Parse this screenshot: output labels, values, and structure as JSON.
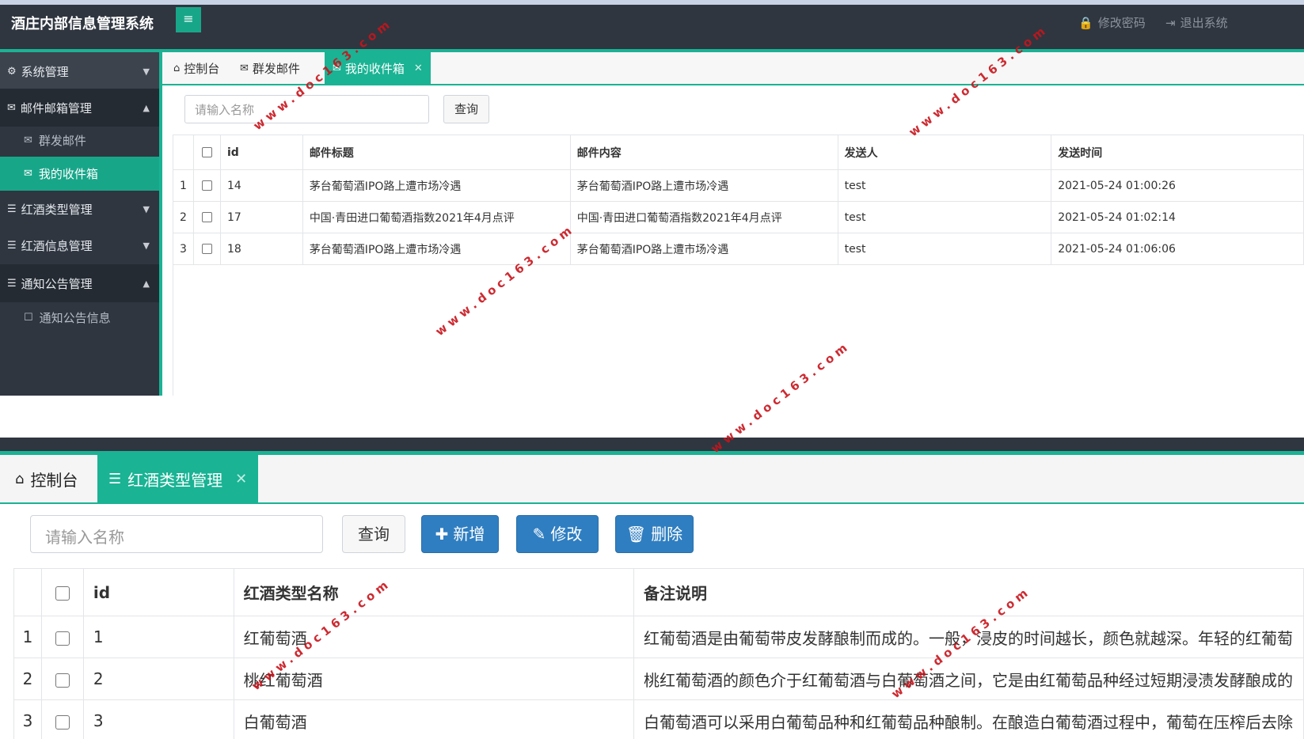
{
  "top": {
    "app_title": "酒庄内部信息管理系统",
    "menu_toggle_icon": "≡",
    "header_links": [
      {
        "icon": "lock-icon",
        "label": "修改密码"
      },
      {
        "icon": "sign-out-icon",
        "label": "退出系统"
      }
    ],
    "sidebar": {
      "items": [
        {
          "label": "系统管理",
          "icon": "gear-icon",
          "expanded": false
        },
        {
          "label": "邮件邮箱管理",
          "icon": "envelope-icon",
          "expanded": true
        },
        {
          "label": "群发邮件",
          "icon": "envelope-icon",
          "sub": true
        },
        {
          "label": "我的收件箱",
          "icon": "envelope-icon",
          "sub": true,
          "active": true
        },
        {
          "label": "红酒类型管理",
          "icon": "list-icon",
          "expanded": false
        },
        {
          "label": "红酒信息管理",
          "icon": "list-icon",
          "expanded": false
        },
        {
          "label": "通知公告管理",
          "icon": "list-icon",
          "expanded": true
        },
        {
          "label": "通知公告信息",
          "icon": "square-icon",
          "sub": true
        }
      ]
    },
    "tabs": [
      {
        "label": "控制台",
        "icon": "home-icon"
      },
      {
        "label": "群发邮件",
        "icon": "envelope-icon"
      },
      {
        "label": "我的收件箱",
        "icon": "envelope-icon",
        "active": true
      }
    ],
    "search": {
      "placeholder": "请输入名称",
      "button": "查询"
    },
    "table": {
      "headers": [
        "id",
        "邮件标题",
        "邮件内容",
        "发送人",
        "发送时间"
      ],
      "rows": [
        {
          "n": "1",
          "id": "14",
          "title": "茅台葡萄酒IPO路上遭市场冷遇",
          "content": "茅台葡萄酒IPO路上遭市场冷遇",
          "sender": "test",
          "time": "2021-05-24 01:00:26"
        },
        {
          "n": "2",
          "id": "17",
          "title": "中国·青田进口葡萄酒指数2021年4月点评",
          "content": "中国·青田进口葡萄酒指数2021年4月点评",
          "sender": "test",
          "time": "2021-05-24 01:02:14"
        },
        {
          "n": "3",
          "id": "18",
          "title": "茅台葡萄酒IPO路上遭市场冷遇",
          "content": "茅台葡萄酒IPO路上遭市场冷遇",
          "sender": "test",
          "time": "2021-05-24 01:06:06"
        }
      ]
    }
  },
  "bottom": {
    "tabs": [
      {
        "label": "控制台",
        "icon": "home-icon"
      },
      {
        "label": "红酒类型管理",
        "icon": "list-icon",
        "active": true
      }
    ],
    "search": {
      "placeholder": "请输入名称",
      "button": "查询"
    },
    "buttons": {
      "add": "新增",
      "edit": "修改",
      "delete": "删除"
    },
    "table": {
      "headers": [
        "id",
        "红酒类型名称",
        "备注说明"
      ],
      "rows": [
        {
          "n": "1",
          "id": "1",
          "name": "红葡萄酒",
          "note": "红葡萄酒是由葡萄带皮发酵酿制而成的。一般，浸皮的时间越长，颜色就越深。年轻的红葡萄"
        },
        {
          "n": "2",
          "id": "2",
          "name": "桃红葡萄酒",
          "note": "桃红葡萄酒的颜色介于红葡萄酒与白葡萄酒之间，它是由红葡萄品种经过短期浸渍发酵酿成的"
        },
        {
          "n": "3",
          "id": "3",
          "name": "白葡萄酒",
          "note": "白葡萄酒可以采用白葡萄品种和红葡萄品种酿制。在酿造白葡萄酒过程中，葡萄在压榨后去除"
        }
      ]
    }
  },
  "watermark": "www.doc163.com",
  "colors": {
    "accent": "#1ab394",
    "dark": "#2f3640",
    "primary_blue": "#2f7ec1",
    "watermark": "#c8141b"
  }
}
